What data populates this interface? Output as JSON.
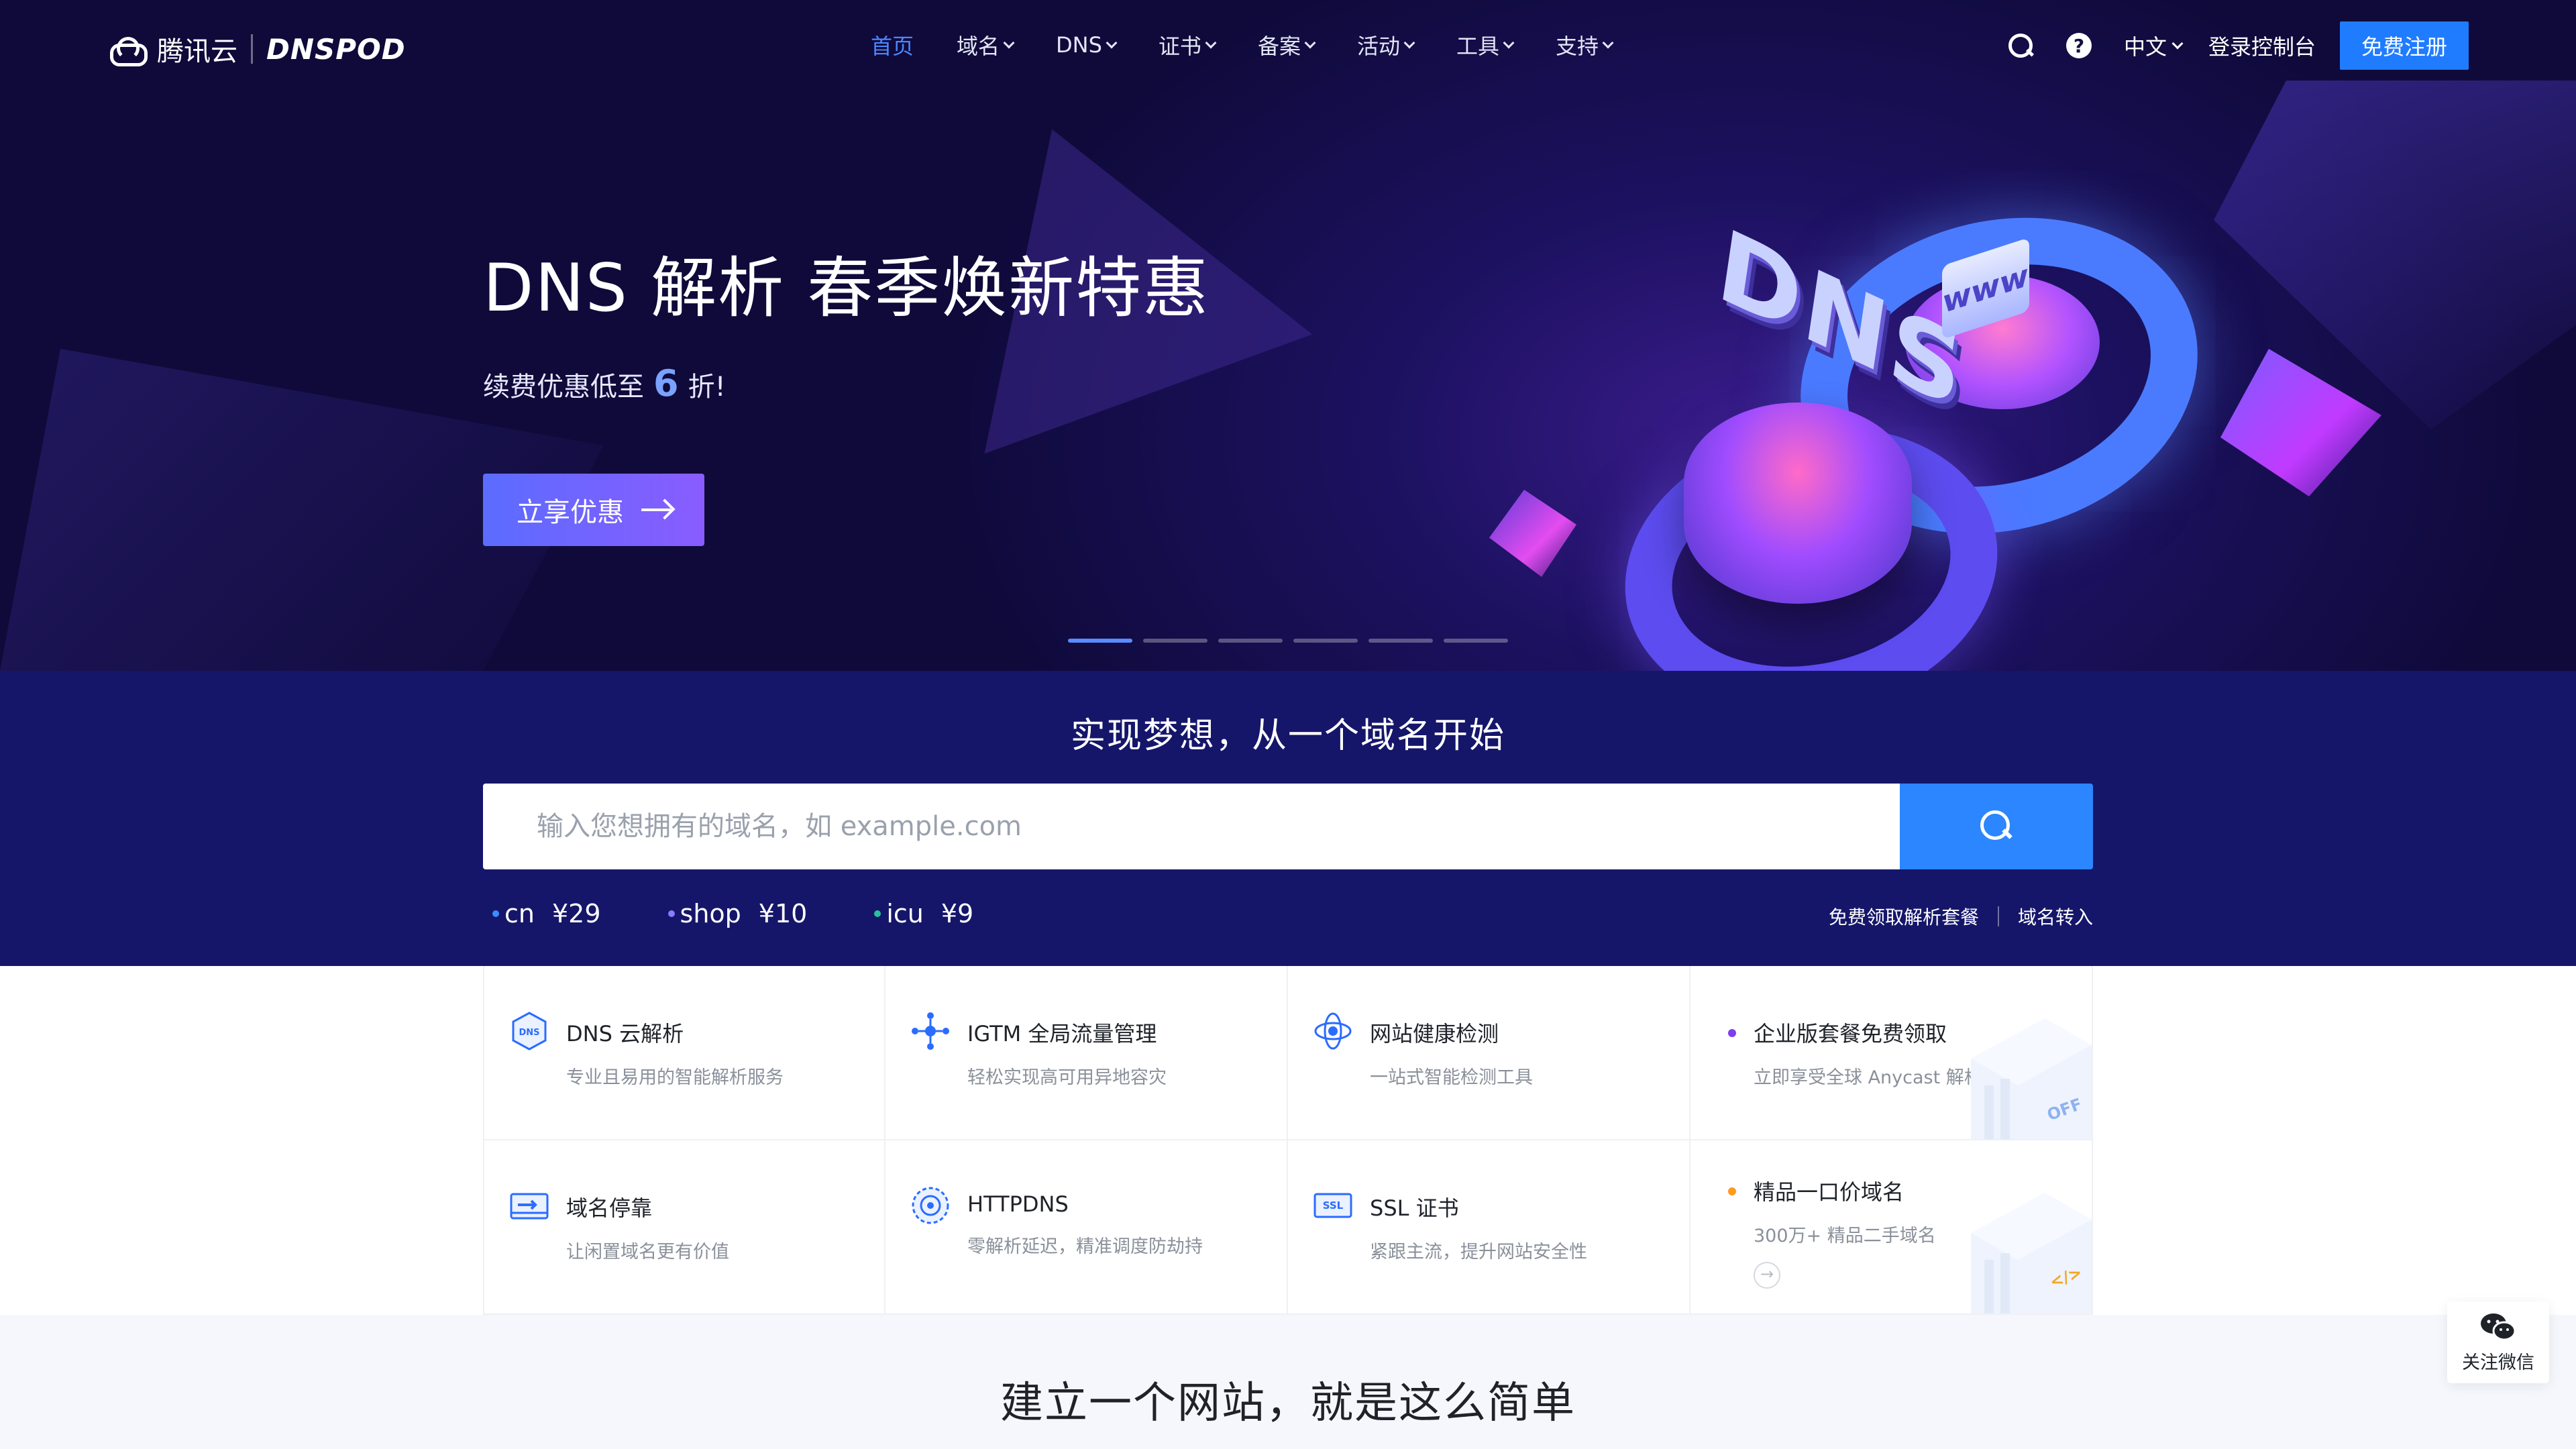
{
  "nav": {
    "logo_cn": "腾讯云",
    "logo_brand": "DNSPOD",
    "menu": [
      {
        "label": "首页",
        "active": true,
        "dropdown": false
      },
      {
        "label": "域名",
        "active": false,
        "dropdown": true
      },
      {
        "label": "DNS",
        "active": false,
        "dropdown": true
      },
      {
        "label": "证书",
        "active": false,
        "dropdown": true
      },
      {
        "label": "备案",
        "active": false,
        "dropdown": true
      },
      {
        "label": "活动",
        "active": false,
        "dropdown": true
      },
      {
        "label": "工具",
        "active": false,
        "dropdown": true
      },
      {
        "label": "支持",
        "active": false,
        "dropdown": true
      }
    ],
    "help_glyph": "?",
    "language": "中文",
    "console_label": "登录控制台",
    "register_label": "免费注册"
  },
  "hero": {
    "title": "DNS 解析 春季焕新特惠",
    "subtitle_prefix": "续费优惠低至",
    "subtitle_number": "6",
    "subtitle_suffix": "折!",
    "cta_label": "立享优惠",
    "art_dns_text": "DNS",
    "art_www_text": "www",
    "carousel_slide_count": 6,
    "carousel_active_index": 0
  },
  "search": {
    "title": "实现梦想，从一个域名开始",
    "placeholder": "输入您想拥有的域名，如 example.com",
    "tlds": [
      {
        "name": "cn",
        "price": "¥29",
        "dot_color": "#3a8dff"
      },
      {
        "name": "shop",
        "price": "¥10",
        "dot_color": "#8b7bff"
      },
      {
        "name": "icu",
        "price": "¥9",
        "dot_color": "#27c39a"
      }
    ],
    "link_free_plan": "免费领取解析套餐",
    "link_transfer": "域名转入"
  },
  "products": [
    {
      "title": "DNS 云解析",
      "desc": "专业且易用的智能解析服务",
      "icon": "dns-cloud-icon"
    },
    {
      "title": "IGTM 全局流量管理",
      "desc": "轻松实现高可用异地容灾",
      "icon": "traffic-management-icon"
    },
    {
      "title": "网站健康检测",
      "desc": "一站式智能检测工具",
      "icon": "health-check-icon"
    },
    {
      "title": "企业版套餐免费领取",
      "desc": "立即享受全球 Anycast 解析加速",
      "promo": true,
      "dot_color": "#7b3ff0",
      "art_text": "OFF"
    },
    {
      "title": "域名停靠",
      "desc": "让闲置域名更有价值",
      "icon": "domain-parking-icon"
    },
    {
      "title": "HTTPDNS",
      "desc": "零解析延迟，精准调度防劫持",
      "icon": "httpdns-icon"
    },
    {
      "title": "SSL 证书",
      "desc": "紧跟主流，提升网站安全性",
      "icon": "ssl-certificate-icon",
      "icon_text": "SSL"
    },
    {
      "title": "精品一口价域名",
      "desc": "300万+ 精品二手域名",
      "promo": true,
      "dot_color": "#ff9a1f",
      "art_text": "</>"
    }
  ],
  "bottom": {
    "title": "建立一个网站，就是这么简单"
  },
  "wechat": {
    "label": "关注微信"
  },
  "colors": {
    "accent": "#1f7cff",
    "nav_active": "#4d86ff",
    "search_band": "#15166a",
    "hero_bg": "#0f0a3a"
  }
}
